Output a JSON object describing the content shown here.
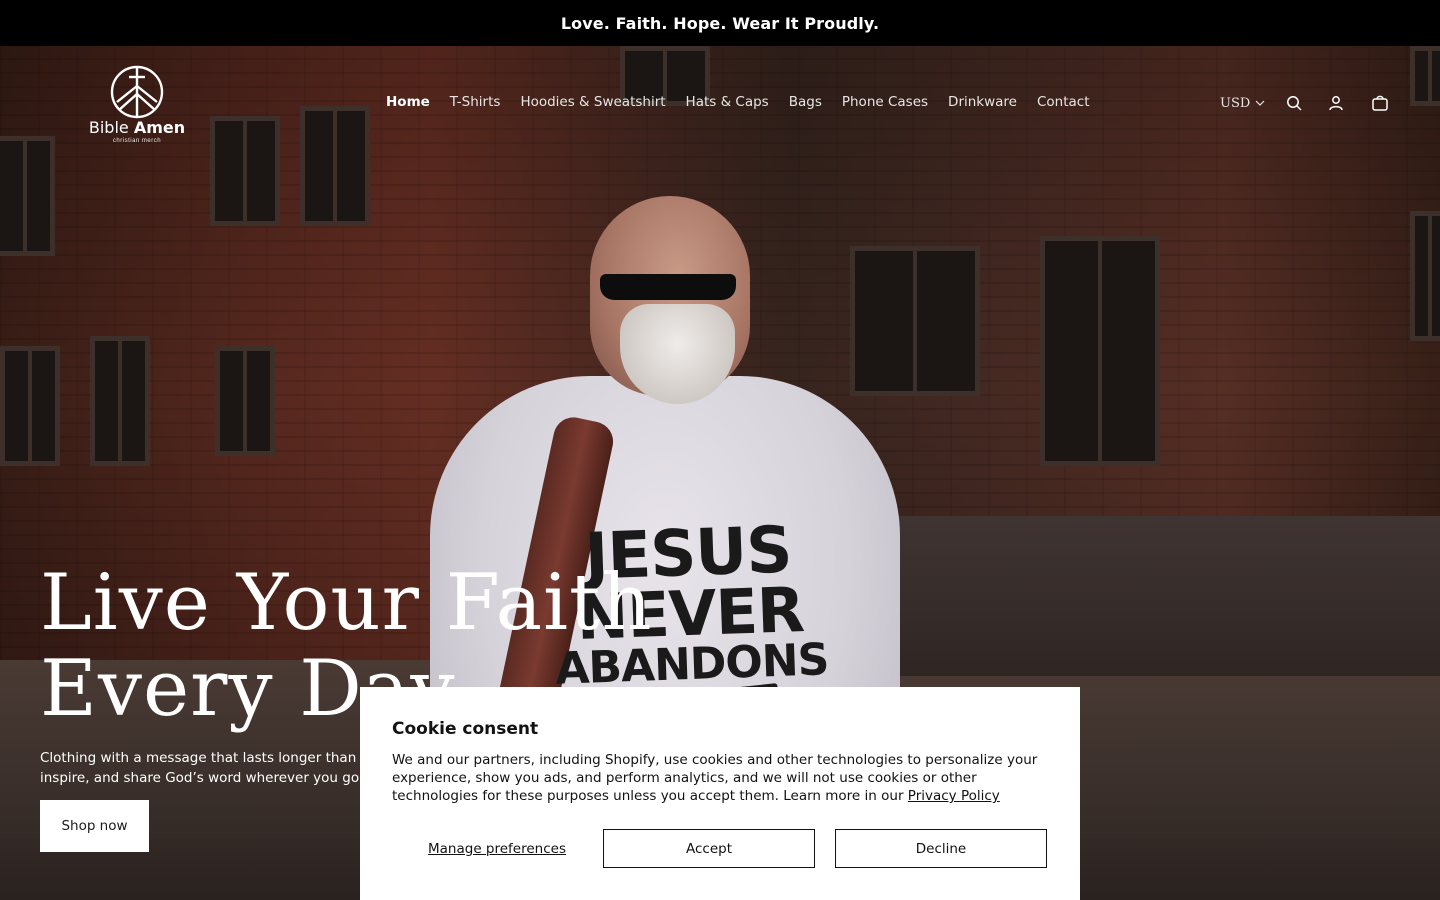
{
  "announcement": {
    "text": "Love. Faith. Hope. Wear It Proudly."
  },
  "logo": {
    "name_light": "Bible",
    "name_bold": "Amen",
    "tagline": "christian merch",
    "icon": "cross-peace-circle-icon"
  },
  "nav": {
    "items": [
      {
        "label": "Home",
        "active": true
      },
      {
        "label": "T-Shirts",
        "active": false
      },
      {
        "label": "Hoodies & Sweatshirt",
        "active": false
      },
      {
        "label": "Hats & Caps",
        "active": false
      },
      {
        "label": "Bags",
        "active": false
      },
      {
        "label": "Phone Cases",
        "active": false
      },
      {
        "label": "Drinkware",
        "active": false
      },
      {
        "label": "Contact",
        "active": false
      }
    ]
  },
  "header_actions": {
    "currency": "USD",
    "icons": [
      "chevron-down-icon",
      "search-icon",
      "account-icon",
      "cart-icon"
    ]
  },
  "hero": {
    "shirt_text": {
      "line1": "JESUS",
      "line2": "NEVER",
      "line3": "ABANDONS"
    },
    "title_line1": "Live Your Faith",
    "title_line2": "Every Day",
    "subtitle_line1": "Clothing with a message that lasts longer than trends",
    "subtitle_line2": "inspire, and share God’s word wherever you go.",
    "cta": "Shop now"
  },
  "cookie": {
    "title": "Cookie consent",
    "body": "We and our partners, including Shopify, use cookies and other technologies to personalize your experience, show you ads, and perform analytics, and we will not use cookies or other technologies for these purposes unless you accept them. Learn more in our ",
    "link": "Privacy Policy",
    "manage": "Manage preferences",
    "accept": "Accept",
    "decline": "Decline"
  },
  "colors": {
    "announcement_bg": "#000000",
    "text_light": "#ffffff",
    "dialog_bg": "#ffffff",
    "dialog_text": "#121212"
  }
}
